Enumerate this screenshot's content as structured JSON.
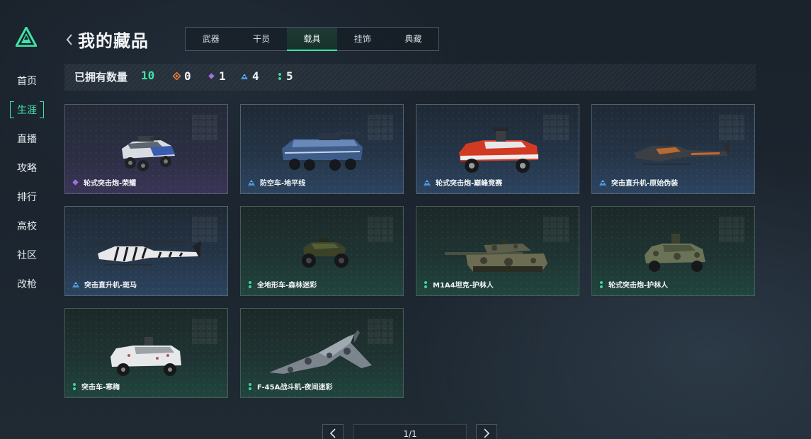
{
  "sidebar": {
    "items": [
      {
        "label": "首页",
        "active": false
      },
      {
        "label": "生涯",
        "active": true
      },
      {
        "label": "直播",
        "active": false
      },
      {
        "label": "攻略",
        "active": false
      },
      {
        "label": "排行",
        "active": false
      },
      {
        "label": "高校",
        "active": false
      },
      {
        "label": "社区",
        "active": false
      },
      {
        "label": "改枪",
        "active": false
      }
    ]
  },
  "header": {
    "title": "我的藏品",
    "tabs": [
      {
        "label": "武器",
        "active": false
      },
      {
        "label": "干员",
        "active": false
      },
      {
        "label": "载具",
        "active": true
      },
      {
        "label": "挂饰",
        "active": false
      },
      {
        "label": "典藏",
        "active": false
      }
    ]
  },
  "summary": {
    "label": "已拥有数量",
    "total": "10",
    "rarities": [
      {
        "icon": "orange-rarity-icon",
        "color": "#e07a3a",
        "count": "0"
      },
      {
        "icon": "purple-rarity-icon",
        "color": "#a070e0",
        "count": "1"
      },
      {
        "icon": "blue-rarity-icon",
        "color": "#4a9ae0",
        "count": "4"
      },
      {
        "icon": "green-rarity-icon",
        "color": "#3fd69a",
        "count": "5"
      }
    ]
  },
  "items": [
    {
      "name": "轮式突击炮-荣耀",
      "rarity": "purple",
      "vehicle": "armored-car"
    },
    {
      "name": "防空车-地平线",
      "rarity": "blue",
      "vehicle": "apc"
    },
    {
      "name": "轮式突击炮-巅峰竞赛",
      "rarity": "blue",
      "vehicle": "armored-car-red"
    },
    {
      "name": "突击直升机-原始伪装",
      "rarity": "blue",
      "vehicle": "helicopter"
    },
    {
      "name": "突击直升机-斑马",
      "rarity": "blue",
      "vehicle": "helicopter-zebra"
    },
    {
      "name": "全地形车-森林迷彩",
      "rarity": "green",
      "vehicle": "atv"
    },
    {
      "name": "M1A4坦克-护林人",
      "rarity": "green",
      "vehicle": "tank"
    },
    {
      "name": "轮式突击炮-护林人",
      "rarity": "green",
      "vehicle": "armored-car-camo"
    },
    {
      "name": "突击车-寒梅",
      "rarity": "green",
      "vehicle": "assault-vehicle"
    },
    {
      "name": "F-45A战斗机-夜间迷彩",
      "rarity": "green",
      "vehicle": "jet"
    }
  ],
  "pagination": {
    "label": "1/1"
  },
  "colors": {
    "accent": "#3fe3a6"
  }
}
